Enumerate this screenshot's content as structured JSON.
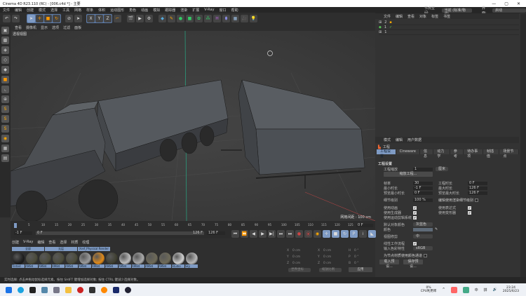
{
  "window": {
    "title": "Cinema 4D R23.110 (RC) - [006.c4d *] - 主要",
    "min": "—",
    "max": "▢",
    "close": "✕"
  },
  "menu": [
    "文件",
    "编辑",
    "创建",
    "模式",
    "选择",
    "工具",
    "网格",
    "样条",
    "体积",
    "运动图形",
    "角色",
    "动画",
    "模拟",
    "跟踪器",
    "渲染",
    "扩展",
    "V-Ray",
    "窗口",
    "帮助"
  ],
  "toolbar": {
    "axes": [
      "X",
      "Y",
      "Z"
    ]
  },
  "viewport": {
    "menu": [
      "查看",
      "摄像机",
      "显示",
      "选项",
      "过滤",
      "面板"
    ],
    "label": "透视视图",
    "grid": "网格间距 : 100 cm"
  },
  "right_top": {
    "node_space_label": "节点空间:",
    "node_space": "当前 (标准/物理)",
    "layout_label": "界面:",
    "layout": "启动"
  },
  "object_manager": {
    "menu": [
      "文件",
      "编辑",
      "查看",
      "对象",
      "标签",
      "书签"
    ],
    "rows": [
      {
        "num": "2"
      },
      {
        "num": "1"
      },
      {
        "num": "1"
      }
    ]
  },
  "attributes": {
    "menu": [
      "模式",
      "编辑",
      "用户数据"
    ],
    "title": "工程",
    "tabs": [
      "工程设置",
      "Cineware",
      "信息",
      "动力学",
      "参考",
      "待办事项",
      "帧插值",
      "场景节点"
    ],
    "section": "工程设置",
    "scale_label": "工程缩放",
    "scale": "1",
    "scale_unit": "厘米",
    "scale_btn": "缩放工程...",
    "fps_label": "帧率",
    "fps": "30",
    "time_label": "工程时长",
    "time": "0 F",
    "min_label": "最小时长",
    "min": "-1 F",
    "max_label": "最大时长",
    "max": "126 F",
    "pmin_label": "预览最小时长",
    "pmin": "0 F",
    "pmax_label": "预览最大时长",
    "pmax": "126 F",
    "lod_label": "细节级别",
    "lod": "100 %",
    "render_lod_label": "编辑使用渲染细节级别",
    "use_anim": "使用动画",
    "use_expr": "使用表达式",
    "use_gen": "使用生成器",
    "use_def": "使用变形器",
    "use_motion": "使用运动剪辑系统",
    "obj_color_label": "默认对象颜色",
    "obj_color": "灰蓝色",
    "color_label": "颜色",
    "clip_label": "视图修剪",
    "clip": "中",
    "linear_label": "线性工作流程",
    "input_color_label": "输入色彩特性",
    "input_color": "sRGB",
    "node_mat_label": "为节点材质使用颜色通道",
    "load_preset": "载入预设...",
    "save_preset": "保存预设...",
    "check": "✔"
  },
  "timeline": {
    "ticks": [
      "0",
      "5",
      "10",
      "15",
      "20",
      "25",
      "30",
      "35",
      "40",
      "45",
      "50",
      "55",
      "60",
      "65",
      "70",
      "75",
      "80",
      "85",
      "90",
      "95",
      "100",
      "105",
      "110",
      "115",
      "120",
      "125"
    ],
    "current": "0 F",
    "start": "-1 F",
    "range_start": "0 F",
    "range_end": "126 F",
    "end": "126 F"
  },
  "materials": {
    "menu": [
      "创建",
      "V-Ray",
      "编辑",
      "查看",
      "选择",
      "材质",
      "纹理"
    ],
    "tabs": [
      "全部",
      "无层",
      "Xref_Physical Render"
    ],
    "items": [
      {
        "name": "Tinted",
        "color": "#1e1e1e"
      },
      {
        "name": "AM84",
        "color": "#4a4a3a"
      },
      {
        "name": "AM84",
        "color": "#4a4a3a"
      },
      {
        "name": "AM84",
        "color": "#4a4a3a"
      },
      {
        "name": "AM84",
        "color": "#4a4a3a"
      },
      {
        "name": "AM84",
        "color": "#9a9a9a"
      },
      {
        "name": "AM84",
        "color": "#e08a1a"
      },
      {
        "name": "AM84",
        "color": "#3e3e30"
      },
      {
        "name": "AM84",
        "color": "#bdbdbd"
      },
      {
        "name": "AM84",
        "color": "#aaaaaa"
      },
      {
        "name": "AM84",
        "color": "#6e6a58"
      },
      {
        "name": "AM84",
        "color": "#6e6a58"
      },
      {
        "name": "Studio",
        "color": "#d0d0d0"
      },
      {
        "name": "Sky",
        "color": "#b8b8b8"
      }
    ]
  },
  "coords": {
    "x": "0 cm",
    "y": "0 cm",
    "z": "0 cm",
    "sx": "0 cm",
    "sy": "0 cm",
    "sz": "0 cm",
    "h": "0 °",
    "p": "0 °",
    "b": "0 °",
    "world": "世界坐标",
    "scale": "缩放比例",
    "apply": "应用"
  },
  "status": "实时选择: 点击并拖动鼠标选择元素。按住 SHIFT 键增加选择对象; 按住 CTRL 键减少选择对象。",
  "taskbar": {
    "cpu": "0%",
    "cpu_label": "CPU利用率",
    "time": "23:24",
    "date": "2025/6/23",
    "ime": "中",
    "ime2": "拼"
  }
}
